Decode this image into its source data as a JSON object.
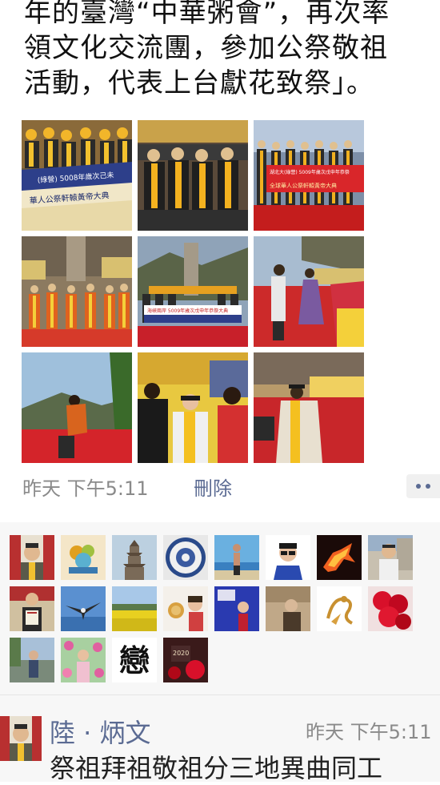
{
  "post": {
    "lines": [
      "年的臺灣“中華粥會”，再次率",
      "領文化交流團，參加公祭敬祖",
      "活動，代表上台獻花致祭」。"
    ]
  },
  "photos": [
    {
      "name": "photo-banner-crowd",
      "banner": "(綠營) 5008年歲次己未",
      "banner2": "華人公祭軒轅黃帝大典"
    },
    {
      "name": "photo-seated-officials"
    },
    {
      "name": "photo-banner-line",
      "banner": "湖北大(綠營) 5009年歲次戊申年恭祭",
      "banner2": "全球華人公祭軒轅黃帝大典"
    },
    {
      "name": "photo-rock-stage"
    },
    {
      "name": "photo-stone-banner",
      "banner": "海峽兩岸 5009年歲次戊申年恭祭大典"
    },
    {
      "name": "photo-dancers"
    },
    {
      "name": "photo-bowing"
    },
    {
      "name": "photo-interview"
    },
    {
      "name": "photo-speaker"
    }
  ],
  "meta": {
    "time": "昨天 下午5:11",
    "delete_label": "刪除"
  },
  "likes": [
    {
      "name": "avatar-man-sign"
    },
    {
      "name": "avatar-flower-art"
    },
    {
      "name": "avatar-pagoda"
    },
    {
      "name": "avatar-porcelain-plate"
    },
    {
      "name": "avatar-man-beach"
    },
    {
      "name": "avatar-man-glasses"
    },
    {
      "name": "avatar-fire-horse"
    },
    {
      "name": "avatar-man-building"
    },
    {
      "name": "avatar-man-certificate"
    },
    {
      "name": "avatar-eagle-sky"
    },
    {
      "name": "avatar-rapeseed-field"
    },
    {
      "name": "avatar-woman-coin"
    },
    {
      "name": "avatar-woman-blue"
    },
    {
      "name": "avatar-elder-room"
    },
    {
      "name": "avatar-gold-phoenix"
    },
    {
      "name": "avatar-red-flowers"
    },
    {
      "name": "avatar-man-road"
    },
    {
      "name": "avatar-woman-flowers"
    },
    {
      "name": "avatar-calligraphy",
      "text": "戀"
    },
    {
      "name": "avatar-photo-card",
      "text": "2020"
    }
  ],
  "comment": {
    "name": "陸 · 炳文",
    "time": "昨天 下午5:11",
    "text": "祭祖拜祖敬祖分三地異曲同工"
  },
  "colors": {
    "link": "#5b6b93",
    "meta_gray": "#8a8a8a",
    "likes_bg": "#f7f7f7"
  }
}
